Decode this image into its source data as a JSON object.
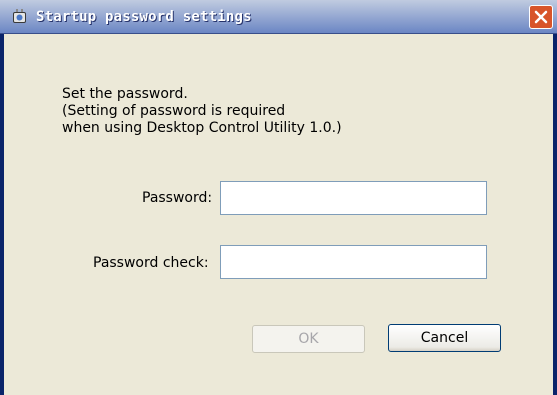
{
  "window": {
    "title": "Startup password settings",
    "title_icon": "app-icon",
    "close_icon": "close-icon"
  },
  "message": {
    "line1": "Set the password.",
    "line2": "(Setting of password is required",
    "line3": "when using Desktop Control Utility 1.0.)"
  },
  "form": {
    "password_label": "Password:",
    "password_value": "",
    "password_check_label": "Password check:",
    "password_check_value": ""
  },
  "buttons": {
    "ok_label": "OK",
    "ok_enabled": false,
    "cancel_label": "Cancel"
  },
  "colors": {
    "title_bar_start": "#c0cbe0",
    "title_bar_end": "#6b86c4",
    "close_button": "#d8542a",
    "dialog_background": "#ece9d8",
    "input_border": "#7f9db9"
  }
}
